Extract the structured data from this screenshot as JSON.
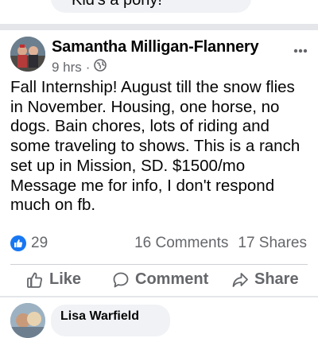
{
  "previous_comment": {
    "text": "Kid's a pony!"
  },
  "post": {
    "author": "Samantha Milligan-Flannery",
    "time": "9 hrs",
    "separator": "·",
    "privacy_icon": "globe-icon",
    "more_icon": "ellipsis-icon",
    "lines": [
      "Fall Internship!  August till the snow flies",
      "in November.  Housing, one horse, no",
      "dogs.  Bain chores, lots of riding and",
      "some traveling to shows.  This is a ranch",
      "set up in Mission, SD.  $1500/mo",
      "Message me for info, I don't respond",
      "much on fb."
    ]
  },
  "engagement": {
    "reaction_icon": "like-reaction-icon",
    "reaction_count": "29",
    "comments": "16 Comments",
    "shares": "17 Shares"
  },
  "actions": {
    "like": "Like",
    "comment": "Comment",
    "share": "Share"
  },
  "next_comment": {
    "author": "Lisa Warfield"
  },
  "colors": {
    "brand_blue": "#1877f2",
    "secondary_text": "#65676b",
    "bubble_bg": "#f0f2f5",
    "divider": "#e4e6ea"
  }
}
